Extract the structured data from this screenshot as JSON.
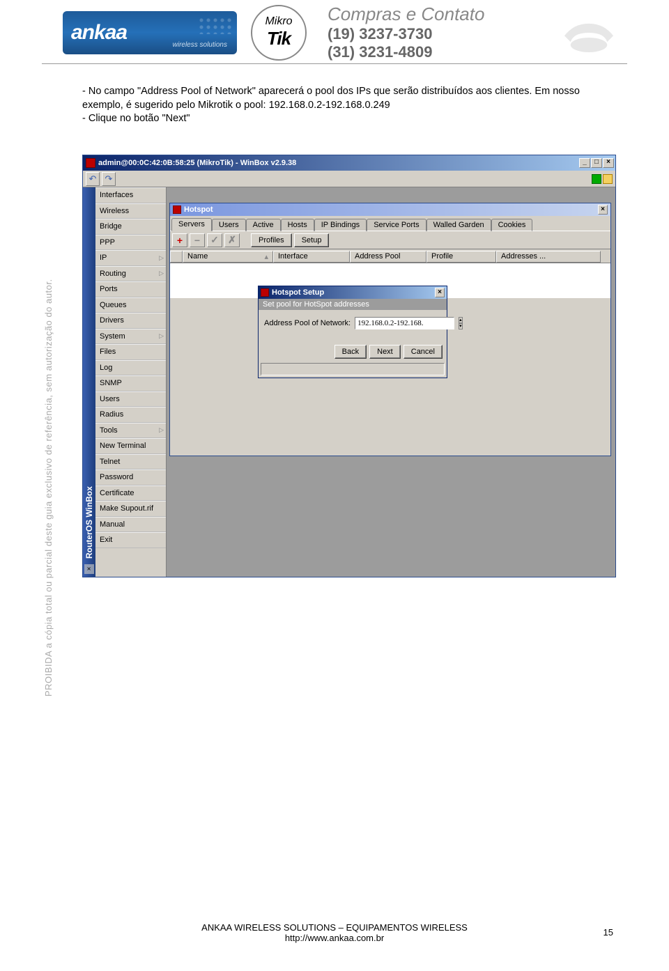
{
  "header": {
    "logo_ankaa_text": "ankaa",
    "logo_ankaa_sub": "wireless solutions",
    "logo_mikrotik_top": "Mikro",
    "logo_mikrotik_bottom": "Tik",
    "contact_title": "Compras e Contato",
    "phone1": "(19) 3237-3730",
    "phone2": "(31) 3231-4809"
  },
  "side_note": "PROIBIDA a cópia total ou parcial deste guia exclusivo de referência, sem autorização do autor.",
  "body": {
    "p1": "- No campo \"Address Pool of Network\" aparecerá o pool dos IPs que serão distribuídos aos clientes. Em nosso exemplo, é sugerido pelo Mikrotik o pool: 192.168.0.2-192.168.0.249",
    "p2": "- Clique no botão \"Next\""
  },
  "winbox": {
    "title": "admin@00:0C:42:0B:58:25 (MikroTik) - WinBox v2.9.38",
    "vtab": "RouterOS WinBox",
    "menu": [
      "Interfaces",
      "Wireless",
      "Bridge",
      "PPP",
      "IP",
      "Routing",
      "Ports",
      "Queues",
      "Drivers",
      "System",
      "Files",
      "Log",
      "SNMP",
      "Users",
      "Radius",
      "Tools",
      "New Terminal",
      "Telnet",
      "Password",
      "Certificate",
      "Make Supout.rif",
      "Manual",
      "Exit"
    ],
    "menu_arrows": [
      "IP",
      "Routing",
      "System",
      "Tools"
    ]
  },
  "hotspot": {
    "title": "Hotspot",
    "tabs": [
      "Servers",
      "Users",
      "Active",
      "Hosts",
      "IP Bindings",
      "Service Ports",
      "Walled Garden",
      "Cookies"
    ],
    "active_tab": "Servers",
    "buttons": {
      "profiles": "Profiles",
      "setup": "Setup"
    },
    "columns": [
      "Name",
      "Interface",
      "Address Pool",
      "Profile",
      "Addresses ..."
    ]
  },
  "setup": {
    "title": "Hotspot Setup",
    "subtitle": "Set pool for HotSpot addresses",
    "field_label": "Address Pool of Network:",
    "field_value": "192.168.0.2-192.168.",
    "buttons": {
      "back": "Back",
      "next": "Next",
      "cancel": "Cancel"
    }
  },
  "footer": {
    "line1": "ANKAA WIRELESS SOLUTIONS – EQUIPAMENTOS WIRELESS",
    "line2": "http://www.ankaa.com.br",
    "page": "15"
  }
}
